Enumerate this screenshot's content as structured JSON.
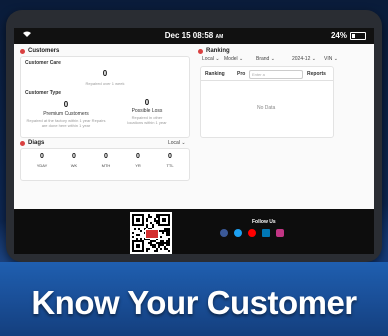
{
  "status_bar": {
    "time": "Dec 15 08:58",
    "ampm": "AM",
    "battery": "24%",
    "battery_level": 0.24
  },
  "customers": {
    "title": "Customers",
    "care": {
      "label": "Customer Care",
      "value": "0",
      "caption": "Repaired over 1 week"
    },
    "type": {
      "label": "Customer Type",
      "premium": {
        "value": "0",
        "label": "Premium Customers",
        "caption": "Repaired at the factory within 1 year Repairs are done here within 1 year"
      },
      "loss": {
        "value": "0",
        "label": "Possible Loss",
        "caption": "Repaired in other locations within 1 year"
      }
    }
  },
  "diags": {
    "title": "Diags",
    "filter": "Local",
    "stats": [
      {
        "value": "0",
        "label": "YDAY"
      },
      {
        "value": "0",
        "label": "WK"
      },
      {
        "value": "0",
        "label": "MTH"
      },
      {
        "value": "0",
        "label": "YR"
      },
      {
        "value": "0",
        "label": "TTL"
      }
    ]
  },
  "ranking": {
    "title": "Ranking",
    "filters": [
      "Local",
      "Model",
      "Brand",
      "2024-12",
      "VIN"
    ],
    "columns": [
      "Ranking",
      "Pro",
      "Reports"
    ],
    "search_placeholder": "Enter a",
    "empty": "No Data"
  },
  "footer": {
    "follow": "Follow Us",
    "social_icons": [
      "facebook-icon",
      "twitter-icon",
      "youtube-icon",
      "linkedin-icon",
      "instagram-icon"
    ]
  },
  "banner": {
    "text": "Know Your Customer"
  }
}
